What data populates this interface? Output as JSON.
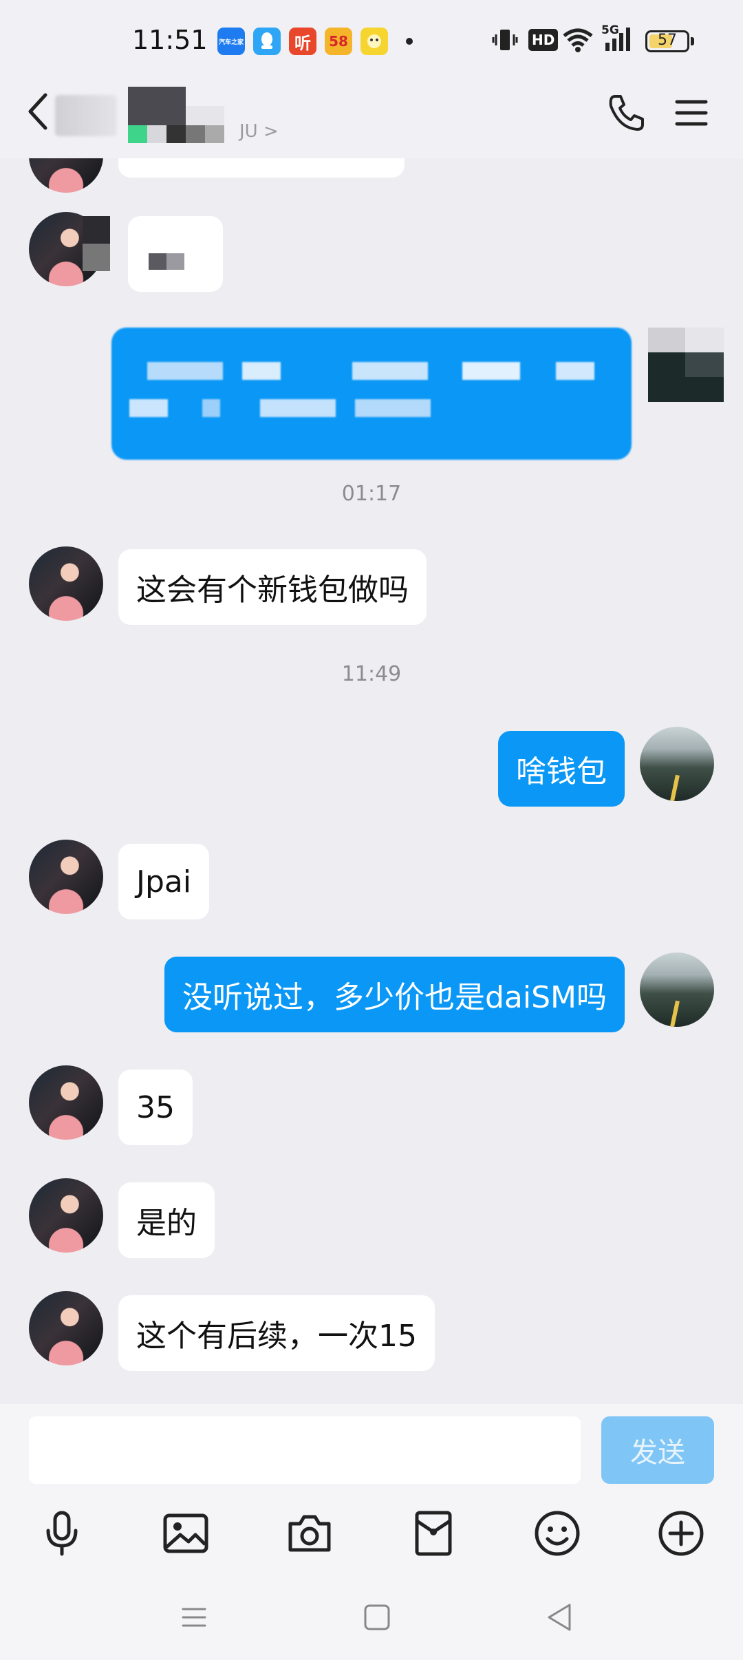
{
  "status_bar": {
    "time": "11:51",
    "apps": [
      {
        "name": "autohome-app-icon",
        "text": "汽车之家",
        "color": "#1e7cf0"
      },
      {
        "name": "qq-app-icon",
        "text": "",
        "color": "#2fa6f5"
      },
      {
        "name": "ting-app-icon",
        "text": "听",
        "color": "#e8472c"
      },
      {
        "name": "58-app-icon",
        "text": "58",
        "color": "#f5b52a"
      },
      {
        "name": "yellow-app-icon",
        "text": "",
        "color": "#f7d531"
      }
    ],
    "hd_label": "HD",
    "network": "5G",
    "battery": "57"
  },
  "header": {
    "subtitle": "JU >"
  },
  "timestamps": {
    "t1": "01:17",
    "t2": "11:49"
  },
  "messages": [
    {
      "side": "in",
      "text": "这会有个新钱包做吗"
    },
    {
      "side": "out",
      "text": "啥钱包"
    },
    {
      "side": "in",
      "text": "Jpai"
    },
    {
      "side": "out",
      "text": "没听说过，多少价也是daiSM吗"
    },
    {
      "side": "in",
      "text": "35"
    },
    {
      "side": "in",
      "text": "是的"
    },
    {
      "side": "in",
      "text": "这个有后续，一次15"
    }
  ],
  "input": {
    "placeholder": "",
    "send_label": "发送"
  },
  "colors": {
    "out_bubble": "#0a97f5",
    "in_bubble": "#ffffff",
    "send_disabled": "#7fc6f6"
  }
}
